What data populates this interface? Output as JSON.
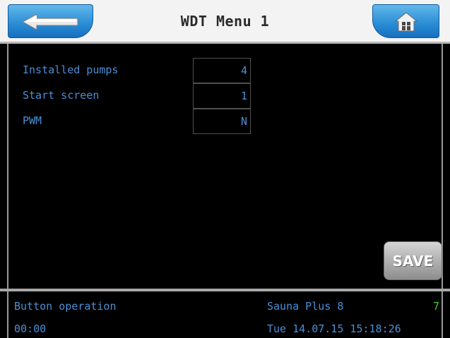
{
  "header": {
    "title": "WDT Menu 1",
    "back_icon": "arrow-left-icon",
    "home_icon": "home-icon"
  },
  "settings": [
    {
      "label": "Installed pumps",
      "value": "4"
    },
    {
      "label": "Start screen",
      "value": "1"
    },
    {
      "label": "PWM",
      "value": "N"
    }
  ],
  "save_button": {
    "label": "SAVE"
  },
  "status": {
    "mode": "Button operation",
    "time_counter": "00:00",
    "product": "Sauna Plus 8",
    "code": "7",
    "datetime": "Tue 14.07.15 15:18:26"
  },
  "colors": {
    "accent_blue": "#2c8fd6",
    "text_blue": "#4a8fd6",
    "status_green": "#3ecf2e"
  }
}
